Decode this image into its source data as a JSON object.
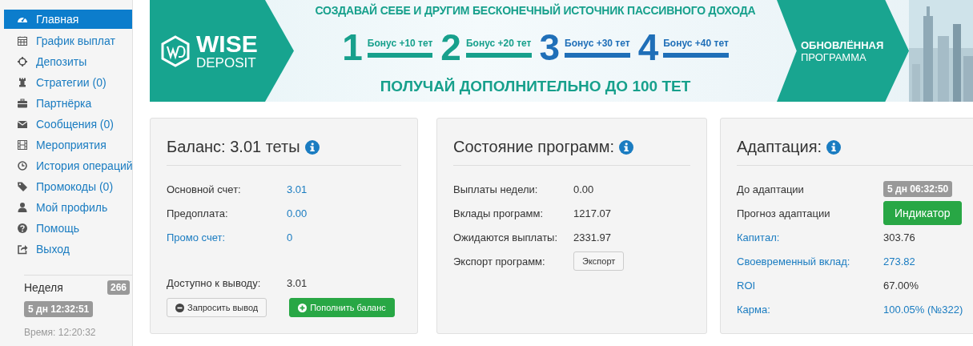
{
  "sidebar": {
    "items": [
      {
        "label": "Главная",
        "selected": true
      },
      {
        "label": "График выплат",
        "selected": false
      },
      {
        "label": "Депозиты",
        "selected": false
      },
      {
        "label": "Стратегии (0)",
        "selected": false
      },
      {
        "label": "Партнёрка",
        "selected": false
      },
      {
        "label": "Сообщения (0)",
        "selected": false
      },
      {
        "label": "Мероприятия",
        "selected": false
      },
      {
        "label": "История операций",
        "selected": false
      },
      {
        "label": "Промокоды (0)",
        "selected": false
      },
      {
        "label": "Мой профиль",
        "selected": false
      },
      {
        "label": "Помощь",
        "selected": false
      },
      {
        "label": "Выход",
        "selected": false
      }
    ],
    "week": {
      "label": "Неделя",
      "count": "266",
      "countdown": "5 дн 12:32:51",
      "time": "Время: 12:20:32"
    }
  },
  "banner": {
    "logo_top": "WISE",
    "logo_bottom": "DEPOSIT",
    "headline": "СОЗДАВАЙ СЕБЕ И ДРУГИМ БЕСКОНЕЧНЫЙ ИСТОЧНИК ПАССИВНОГО ДОХОДА",
    "steps": [
      {
        "number": "1",
        "label": "Бонус +10 тет",
        "color": "#17a08c"
      },
      {
        "number": "2",
        "label": "Бонус +20 тет",
        "color": "#17a08c"
      },
      {
        "number": "3",
        "label": "Бонус +30 тет",
        "color": "#1f6fb8"
      },
      {
        "number": "4",
        "label": "Бонус +40 тет",
        "color": "#1f6fb8"
      }
    ],
    "subline": "ПОЛУЧАЙ ДОПОЛНИТЕЛЬНО ДО 100 ТЕТ",
    "side_top": "ОБНОВЛЁННАЯ",
    "side_bottom": "ПРОГРАММА"
  },
  "cards": [
    {
      "title": "Баланс: 3.01 теты",
      "rows": [
        {
          "label": "Основной счет:",
          "label_link": false,
          "value": "3.01",
          "kind": "link",
          "separated": false
        },
        {
          "label": "Предоплата:",
          "label_link": false,
          "value": "0.00",
          "kind": "link",
          "separated": false
        },
        {
          "label": "Промо счет:",
          "label_link": true,
          "value": "0",
          "kind": "link",
          "separated": false
        },
        {
          "label": "Доступно к выводу:",
          "label_link": false,
          "value": "3.01",
          "kind": "text",
          "separated": true
        }
      ],
      "buttons": [
        {
          "label": "Запросить вывод",
          "kind": "default"
        },
        {
          "label": "Пополнить баланс",
          "kind": "success"
        }
      ]
    },
    {
      "title": "Состояние программ:",
      "rows": [
        {
          "label": "Выплаты недели:",
          "label_link": false,
          "value": "0.00",
          "kind": "text",
          "separated": false
        },
        {
          "label": "Вклады программ:",
          "label_link": false,
          "value": "1217.07",
          "kind": "text",
          "separated": false
        },
        {
          "label": "Ожидаются выплаты:",
          "label_link": false,
          "value": "2331.97",
          "kind": "text",
          "separated": false
        },
        {
          "label": "Экспорт программ:",
          "label_link": false,
          "value": "Экспорт",
          "kind": "small-button",
          "separated": false
        }
      ]
    },
    {
      "title": "Адаптация:",
      "rows": [
        {
          "label": "До адаптации",
          "label_link": false,
          "value": "5 дн 06:32:50",
          "kind": "badge",
          "separated": false
        },
        {
          "label": "Прогноз адаптации",
          "label_link": false,
          "value": "Индикатор",
          "kind": "big-button",
          "separated": false
        },
        {
          "label": "Капитал:",
          "label_link": true,
          "value": "303.76",
          "kind": "text",
          "separated": false
        },
        {
          "label": "Своевременный вклад:",
          "label_link": true,
          "value": "273.82",
          "kind": "link",
          "separated": false
        },
        {
          "label": "ROI",
          "label_link": true,
          "value": "67.00%",
          "kind": "text",
          "separated": false
        },
        {
          "label": "Карма:",
          "label_link": true,
          "value": "100.05% (№322)",
          "kind": "link",
          "separated": false
        }
      ]
    }
  ]
}
